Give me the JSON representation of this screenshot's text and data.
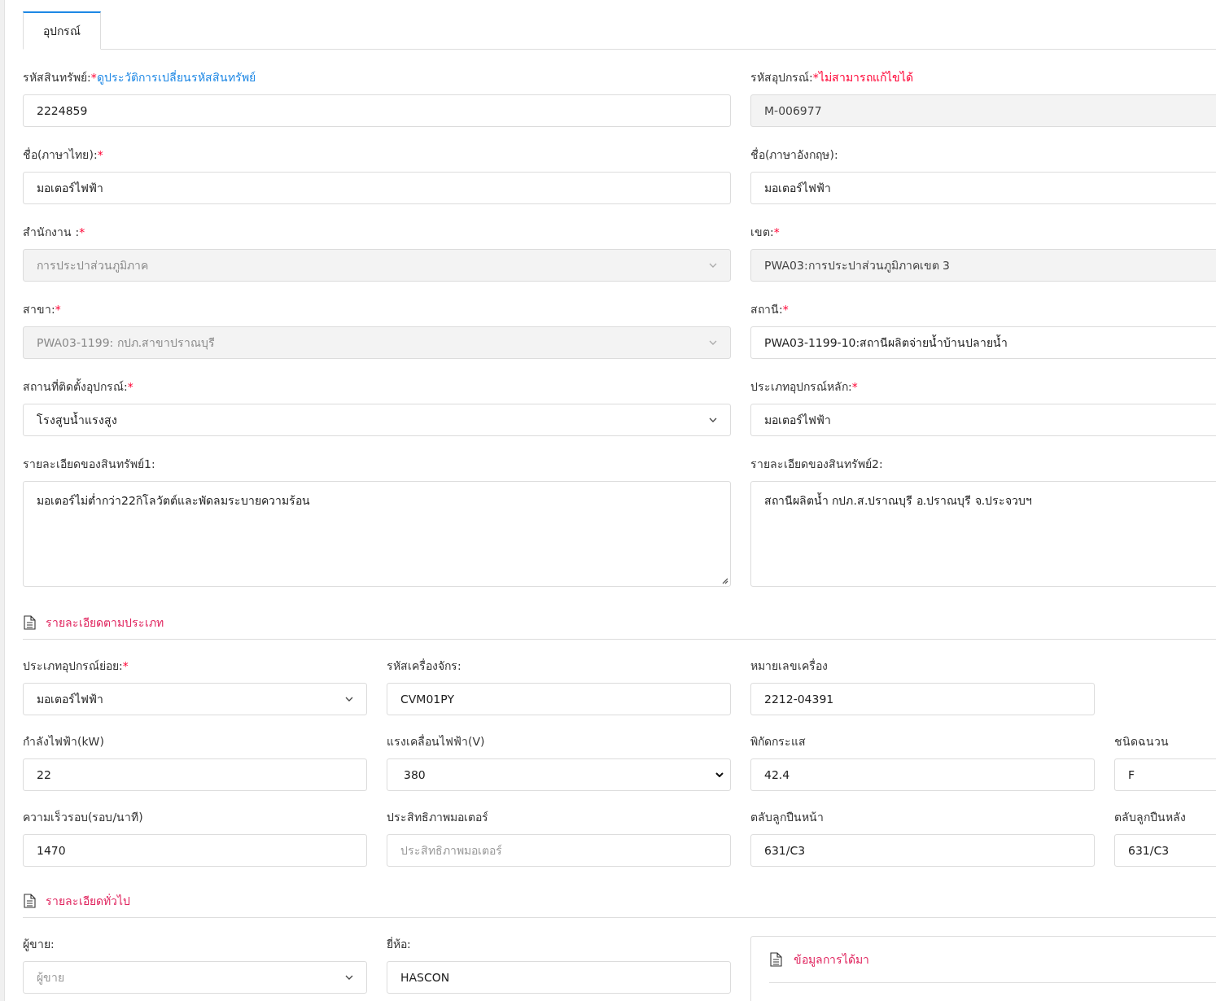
{
  "tabs": [
    {
      "label": "อุปกรณ์",
      "selected": true
    }
  ],
  "main_fields": [
    {
      "label": "รหัสสินทรัพย์:",
      "mark": "*",
      "note": {
        "text": "ดูประวัติการเปลี่ยนรหัสสินทรัพย์",
        "kind": "link"
      },
      "kind": "input",
      "disabled": false,
      "value": "2224859"
    },
    {
      "label": "รหัสอุปกรณ์:",
      "mark": "*",
      "note": {
        "text": "ไม่สามารถแก้ไขได้",
        "kind": "warning"
      },
      "kind": "input",
      "disabled": true,
      "value": "M-006977"
    },
    {
      "label": "ชื่อ(ภาษาไทย):",
      "mark": "*",
      "kind": "input",
      "disabled": false,
      "value": "มอเตอร์ไฟฟ้า"
    },
    {
      "label": "ชื่อ(ภาษาอังกฤษ):",
      "kind": "input",
      "disabled": false,
      "value": "มอเตอร์ไฟฟ้า"
    },
    {
      "label": "สำนักงาน :",
      "mark": "*",
      "kind": "select",
      "disabled": true,
      "value": "การประปาส่วนภูมิภาค"
    },
    {
      "label": "เขต:",
      "mark": "*",
      "kind": "input",
      "disabled": true,
      "value": "PWA03:การประปาส่วนภูมิภาคเขต 3"
    },
    {
      "label": "สาขา:",
      "mark": "*",
      "kind": "select",
      "disabled": true,
      "value": "PWA03-1199: กปภ.สาขาปราณบุรี"
    },
    {
      "label": "สถานี:",
      "mark": "*",
      "kind": "input",
      "disabled": false,
      "value": "PWA03-1199-10:สถานีผลิตจ่ายน้ำบ้านปลายน้ำ"
    },
    {
      "label": "สถานที่ติดตั้งอุปกรณ์:",
      "mark": "*",
      "kind": "select",
      "disabled": false,
      "value": "โรงสูบน้ำแรงสูง"
    },
    {
      "label": "ประเภทอุปกรณ์หลัก:",
      "mark": "*",
      "kind": "input",
      "disabled": false,
      "value": "มอเตอร์ไฟฟ้า"
    },
    {
      "label": "รายละเอียดของสินทรัพย์1:",
      "kind": "textarea",
      "disabled": false,
      "value": "มอเตอร์ไม่ต่ำกว่า22กิโลวัตต์และพัดลมระบายความร้อน"
    },
    {
      "label": "รายละเอียดของสินทรัพย์2:",
      "kind": "textarea",
      "disabled": false,
      "value": "สถานีผลิตน้ำ กปภ.ส.ปราณบุรี อ.ปราณบุรี จ.ประจวบฯ"
    }
  ],
  "type_section": {
    "title": "รายละเอียดตามประเภท",
    "rows": [
      [
        {
          "label": "ประเภทอุปกรณ์ย่อย:",
          "mark": "*",
          "kind": "select",
          "value": "มอเตอร์ไฟฟ้า"
        },
        {
          "label": "รหัสเครื่องจักร:",
          "kind": "input",
          "value": "CVM01PY"
        },
        {
          "label": "หมายเลขเครื่อง",
          "kind": "input",
          "value": "2212-04391"
        }
      ],
      [
        {
          "label": "กำลังไฟฟ้า(kW)",
          "kind": "input",
          "value": "22"
        },
        {
          "label": "แรงเคลื่อนไฟฟ้า(V)",
          "kind": "native-select",
          "value": "380"
        },
        {
          "label": "พิกัดกระแส",
          "kind": "input",
          "value": "42.4"
        },
        {
          "label": "ชนิดฉนวน",
          "kind": "input",
          "value": "F"
        }
      ],
      [
        {
          "label": "ความเร็วรอบ(รอบ/นาที)",
          "kind": "input",
          "value": "1470"
        },
        {
          "label": "ประสิทธิภาพมอเตอร์",
          "kind": "input",
          "placeholder": "ประสิทธิภาพมอเตอร์"
        },
        {
          "label": "ตลับลูกปืนหน้า",
          "kind": "input",
          "value": "631/C3"
        },
        {
          "label": "ตลับลูกปืนหลัง",
          "kind": "input",
          "value": "631/C3"
        }
      ]
    ]
  },
  "general_section": {
    "title": "รายละเอียดทั่วไป",
    "fields": [
      {
        "label": "ผู้ขาย:",
        "kind": "select",
        "placeholder": "ผู้ขาย"
      },
      {
        "label": "ยี่ห้อ:",
        "kind": "input",
        "value": "HASCON"
      }
    ],
    "panel": {
      "title": "ข้อมูลการได้มา"
    }
  }
}
